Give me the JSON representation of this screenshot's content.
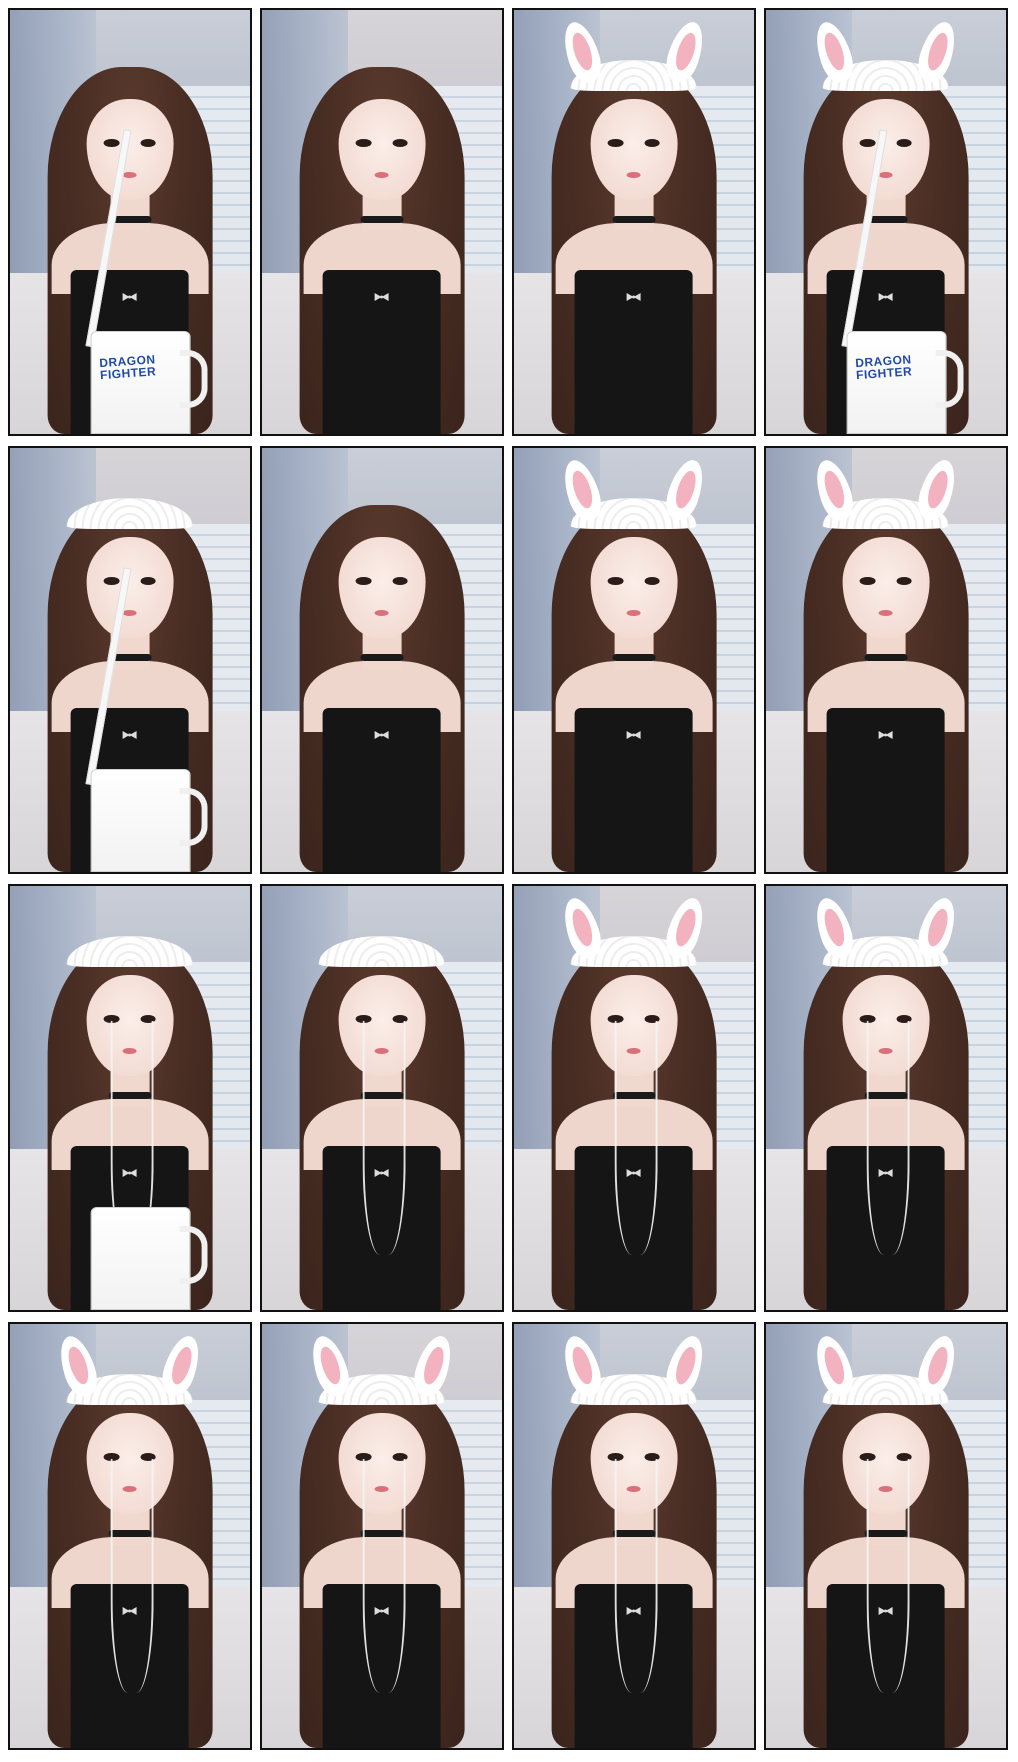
{
  "grid": {
    "columns": 4,
    "rows": 4,
    "frames": [
      {
        "props": [
          "mug",
          "straw"
        ],
        "bunny_ears": false,
        "headband": false,
        "earphones": false,
        "mug_text": "DRAGON FIGHTER"
      },
      {
        "props": [],
        "bunny_ears": false,
        "headband": false,
        "earphones": false,
        "mug_text": ""
      },
      {
        "props": [],
        "bunny_ears": true,
        "headband": true,
        "earphones": false,
        "mug_text": ""
      },
      {
        "props": [
          "mug",
          "straw"
        ],
        "bunny_ears": true,
        "headband": true,
        "earphones": false,
        "mug_text": "DRAGON FIGHTER"
      },
      {
        "props": [
          "mug",
          "straw"
        ],
        "bunny_ears": false,
        "headband": true,
        "earphones": false,
        "mug_text": ""
      },
      {
        "props": [],
        "bunny_ears": false,
        "headband": false,
        "earphones": false,
        "mug_text": ""
      },
      {
        "props": [],
        "bunny_ears": true,
        "headband": true,
        "earphones": false,
        "mug_text": ""
      },
      {
        "props": [],
        "bunny_ears": true,
        "headband": true,
        "earphones": false,
        "mug_text": ""
      },
      {
        "props": [
          "mug"
        ],
        "bunny_ears": false,
        "headband": true,
        "earphones": true,
        "mug_text": ""
      },
      {
        "props": [],
        "bunny_ears": false,
        "headband": true,
        "earphones": true,
        "mug_text": ""
      },
      {
        "props": [],
        "bunny_ears": true,
        "headband": true,
        "earphones": true,
        "mug_text": ""
      },
      {
        "props": [],
        "bunny_ears": true,
        "headband": true,
        "earphones": true,
        "mug_text": ""
      },
      {
        "props": [],
        "bunny_ears": true,
        "headband": true,
        "earphones": true,
        "mug_text": ""
      },
      {
        "props": [],
        "bunny_ears": true,
        "headband": true,
        "earphones": true,
        "mug_text": ""
      },
      {
        "props": [],
        "bunny_ears": true,
        "headband": true,
        "earphones": true,
        "mug_text": ""
      },
      {
        "props": [],
        "bunny_ears": true,
        "headband": true,
        "earphones": true,
        "mug_text": ""
      }
    ]
  },
  "colors": {
    "frame_border": "#111111",
    "page_background": "#ffffff",
    "top": "#151515",
    "hair": "#4a2e24",
    "skin": "#f3dcd4",
    "bunny_ear_inner": "#f3b2c0"
  },
  "icons": {
    "bow": "bow-icon"
  }
}
